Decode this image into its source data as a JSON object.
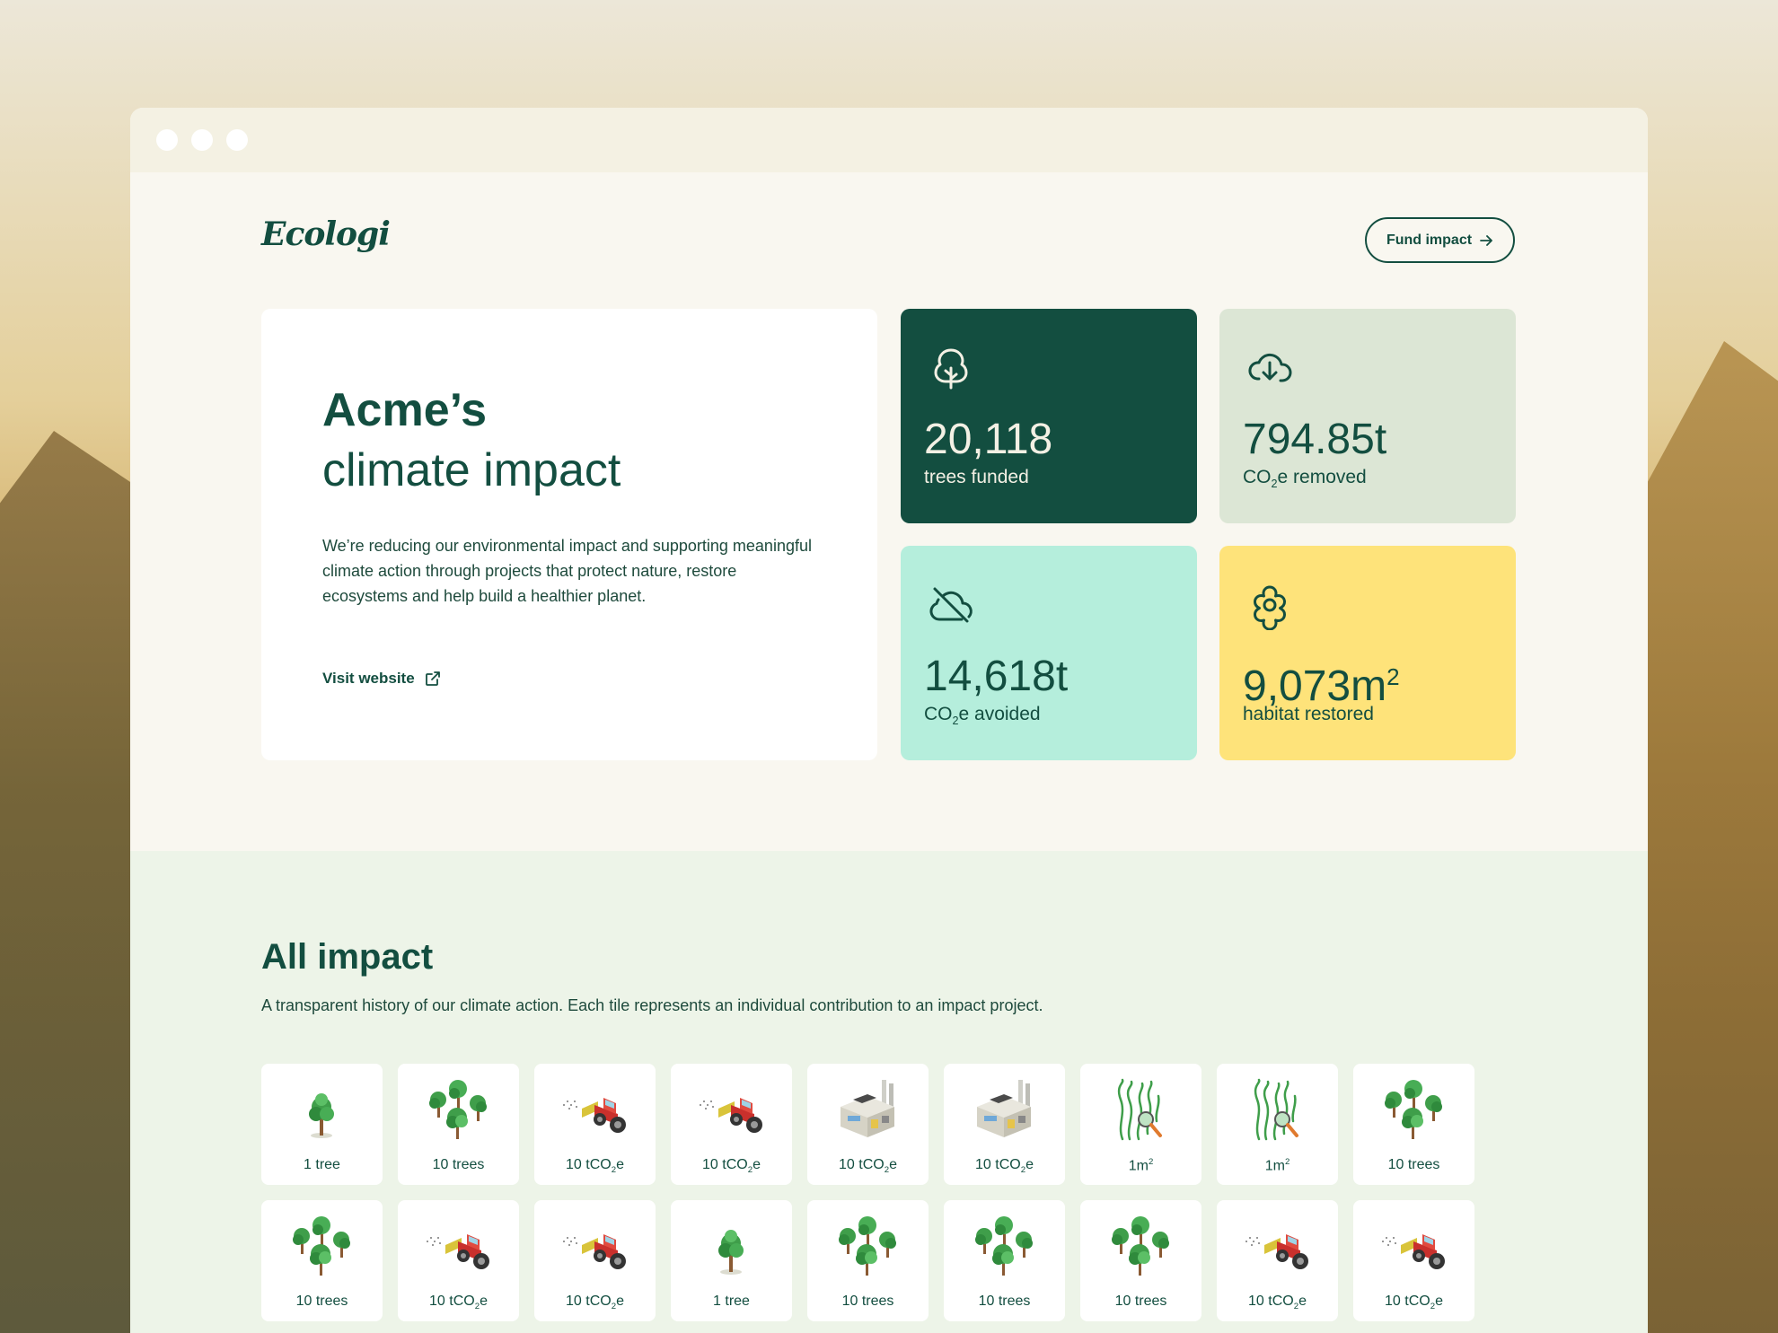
{
  "brand": {
    "logo": "Ecologi"
  },
  "header": {
    "fund_label": "Fund impact",
    "fund_icon": "arrow-right-icon"
  },
  "intro": {
    "title_bold": "Acme’s",
    "title_rest": "climate impact",
    "description": "We’re reducing our environmental impact and supporting meaningful climate action through projects that protect nature, restore ecosystems and help build a healthier planet.",
    "visit_label": "Visit website",
    "visit_icon": "external-link-icon"
  },
  "stats": [
    {
      "value": "20,118",
      "label": "trees funded",
      "icon": "tree-icon"
    },
    {
      "value": "794.85t",
      "label_pre": "CO",
      "label_sub": "2",
      "label_post": "e removed",
      "icon": "cloud-download-icon"
    },
    {
      "value": "14,618t",
      "label_pre": "CO",
      "label_sub": "2",
      "label_post": "e avoided",
      "icon": "cloud-off-icon"
    },
    {
      "value": "9,073m",
      "value_sup": "2",
      "label": "habitat restored",
      "icon": "flower-icon"
    }
  ],
  "all_impact": {
    "title": "All impact",
    "subtitle": "A transparent history of our climate action. Each tile represents an individual contribution to an impact project."
  },
  "tiles": [
    {
      "kind": "tree1",
      "pre": "1 tree",
      "sub": "",
      "post": ""
    },
    {
      "kind": "trees",
      "pre": "10 trees",
      "sub": "",
      "post": ""
    },
    {
      "kind": "tractor",
      "pre": "10 tCO",
      "sub": "2",
      "post": "e"
    },
    {
      "kind": "tractor",
      "pre": "10 tCO",
      "sub": "2",
      "post": "e"
    },
    {
      "kind": "factory",
      "pre": "10 tCO",
      "sub": "2",
      "post": "e"
    },
    {
      "kind": "factory",
      "pre": "10 tCO",
      "sub": "2",
      "post": "e"
    },
    {
      "kind": "seagrass",
      "pre": "1m",
      "sup": "2",
      "post": ""
    },
    {
      "kind": "seagrass",
      "pre": "1m",
      "sup": "2",
      "post": ""
    },
    {
      "kind": "trees",
      "pre": "10 trees",
      "sub": "",
      "post": ""
    },
    {
      "kind": "trees",
      "pre": "10 trees",
      "sub": "",
      "post": ""
    },
    {
      "kind": "tractor",
      "pre": "10 tCO",
      "sub": "2",
      "post": "e"
    },
    {
      "kind": "tractor",
      "pre": "10 tCO",
      "sub": "2",
      "post": "e"
    },
    {
      "kind": "tree1",
      "pre": "1 tree",
      "sub": "",
      "post": ""
    },
    {
      "kind": "trees",
      "pre": "10 trees",
      "sub": "",
      "post": ""
    },
    {
      "kind": "trees",
      "pre": "10 trees",
      "sub": "",
      "post": ""
    },
    {
      "kind": "trees",
      "pre": "10 trees",
      "sub": "",
      "post": ""
    },
    {
      "kind": "tractor",
      "pre": "10 tCO",
      "sub": "2",
      "post": "e"
    },
    {
      "kind": "tractor",
      "pre": "10 tCO",
      "sub": "2",
      "post": "e"
    }
  ],
  "colors": {
    "primary": "#134e40",
    "mint": "#b5eedc",
    "sage": "#dce6d5",
    "yellow": "#fee37a"
  }
}
